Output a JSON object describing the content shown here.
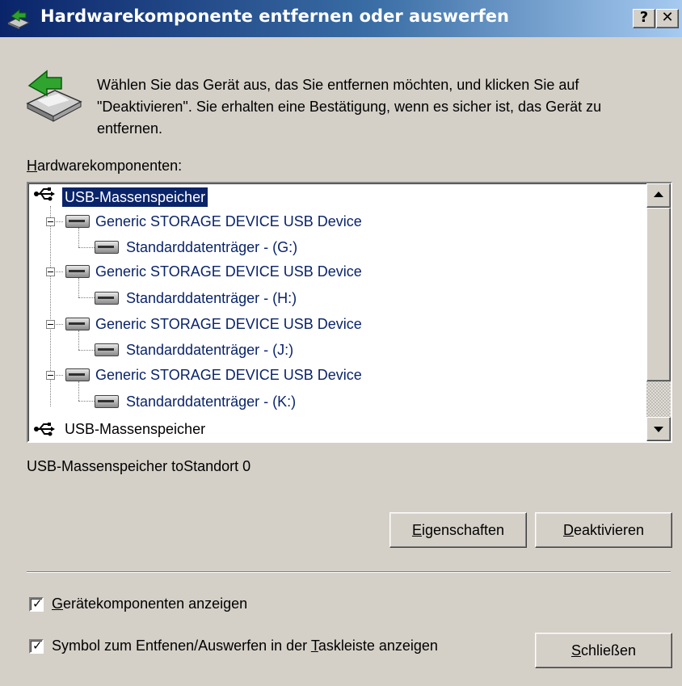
{
  "window": {
    "title": "Hardwarekomponente entfernen oder auswerfen",
    "help_button": "?",
    "close_button": "✕"
  },
  "intro_text": "Wählen Sie das Gerät aus, das Sie entfernen möchten, und klicken Sie auf \"Deaktivieren\". Sie erhalten eine Bestätigung, wenn es sicher ist, das Gerät zu entfernen.",
  "list": {
    "label_prefix": "H",
    "label_rest": "ardwarekomponenten:",
    "items": [
      {
        "label": "USB-Massenspeicher",
        "icon": "usb-icon",
        "selected": true
      },
      {
        "label": "Generic STORAGE DEVICE USB Device",
        "icon": "drive-icon"
      },
      {
        "label": "Standarddatenträger - (G:)",
        "icon": "drive-icon"
      },
      {
        "label": "Generic STORAGE DEVICE USB Device",
        "icon": "drive-icon"
      },
      {
        "label": "Standarddatenträger - (H:)",
        "icon": "drive-icon"
      },
      {
        "label": "Generic STORAGE DEVICE USB Device",
        "icon": "drive-icon"
      },
      {
        "label": "Standarddatenträger - (J:)",
        "icon": "drive-icon"
      },
      {
        "label": "Generic STORAGE DEVICE USB Device",
        "icon": "drive-icon"
      },
      {
        "label": "Standarddatenträger - (K:)",
        "icon": "drive-icon"
      },
      {
        "label": "USB-Massenspeicher",
        "icon": "usb-icon"
      }
    ]
  },
  "status_text": "USB-Massenspeicher toStandort 0",
  "buttons": {
    "properties_u": "E",
    "properties_rest": "igenschaften",
    "deactivate_u": "D",
    "deactivate_rest": "eaktivieren",
    "close_u": "S",
    "close_rest": "chließen"
  },
  "checkboxes": {
    "show_components_u": "G",
    "show_components_rest": "erätekomponenten anzeigen",
    "show_components_checked": true,
    "tray_icon_pre": "Symbol zum Entfenen/Auswerfen in der ",
    "tray_icon_u": "T",
    "tray_icon_rest": "askleiste anzeigen",
    "tray_icon_checked": true
  }
}
